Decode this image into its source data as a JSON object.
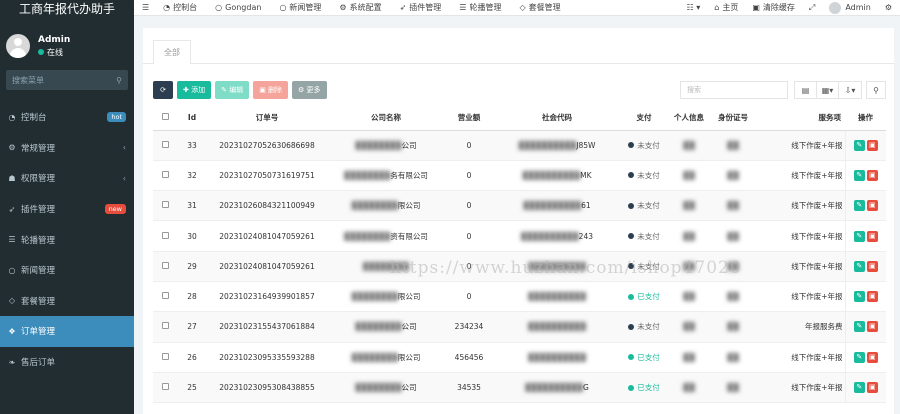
{
  "brand": "工商年报代办助手",
  "user": {
    "name": "Admin",
    "status": "在线"
  },
  "sidebar": {
    "search_placeholder": "搜索菜单",
    "items": [
      {
        "label": "控制台",
        "icon": "dashboard-icon",
        "badge": "hot"
      },
      {
        "label": "常规管理",
        "icon": "cogs-icon",
        "caret": "‹"
      },
      {
        "label": "权限管理",
        "icon": "group-icon",
        "caret": "‹"
      },
      {
        "label": "插件管理",
        "icon": "rocket-icon",
        "badge": "new"
      },
      {
        "label": "轮播管理",
        "icon": "list-icon"
      },
      {
        "label": "新闻管理",
        "icon": "circle-icon"
      },
      {
        "label": "套餐管理",
        "icon": "diamond-icon"
      },
      {
        "label": "订单管理",
        "icon": "cubes-icon",
        "active": true
      },
      {
        "label": "售后订单",
        "icon": "leaf-icon"
      }
    ]
  },
  "topnav": {
    "items": [
      "控制台",
      "Gongdan",
      "新闻管理",
      "系统配置",
      "插件管理",
      "轮播管理",
      "套餐管理"
    ],
    "home": "主页",
    "clear_cache": "清除缓存",
    "admin": "Admin"
  },
  "tabs": [
    "全部"
  ],
  "toolbar": {
    "add": "添加",
    "edit": "编辑",
    "delete": "删除",
    "more": "更多",
    "search_placeholder": "搜索"
  },
  "table": {
    "headers": [
      "Id",
      "订单号",
      "公司名称",
      "营业额",
      "社会代码",
      "支付",
      "个人信息",
      "身份证号",
      "服务项",
      "操作"
    ],
    "rows": [
      {
        "id": "33",
        "order": "20231027052630686698",
        "company": "公司",
        "revenue": "0",
        "code": "J85W",
        "pay": "未支付",
        "paid": false,
        "service": "线下作废+年报"
      },
      {
        "id": "32",
        "order": "20231027050731619751",
        "company": "务有限公司",
        "revenue": "0",
        "code": "MK",
        "pay": "未支付",
        "paid": false,
        "service": "线下作废+年报"
      },
      {
        "id": "31",
        "order": "20231026084321100949",
        "company": "限公司",
        "revenue": "0",
        "code": "61",
        "pay": "未支付",
        "paid": false,
        "service": "线下作废+年报"
      },
      {
        "id": "30",
        "order": "20231024081047059261",
        "company": "资有限公司",
        "revenue": "0",
        "code": "243",
        "pay": "未支付",
        "paid": false,
        "service": "线下作废+年报"
      },
      {
        "id": "29",
        "order": "20231024081047059261",
        "company": "",
        "revenue": "0",
        "code": "",
        "pay": "未支付",
        "paid": false,
        "service": "线下作废+年报"
      },
      {
        "id": "28",
        "order": "20231023164939901857",
        "company": "限公司",
        "revenue": "0",
        "code": "",
        "pay": "已支付",
        "paid": true,
        "service": "线下作废+年报"
      },
      {
        "id": "27",
        "order": "20231023155437061884",
        "company": "公司",
        "revenue": "234234",
        "code": "",
        "pay": "未支付",
        "paid": false,
        "service": "年报服务费"
      },
      {
        "id": "26",
        "order": "20231023095335593288",
        "company": "限公司",
        "revenue": "456456",
        "code": "",
        "pay": "已支付",
        "paid": true,
        "service": "线下作废+年报"
      },
      {
        "id": "25",
        "order": "20231023095308438855",
        "company": "公司",
        "revenue": "34535",
        "code": "G",
        "pay": "已支付",
        "paid": true,
        "service": "线下作废+年报"
      }
    ]
  },
  "watermark": "https://www.huzhan.com/ishop47020"
}
